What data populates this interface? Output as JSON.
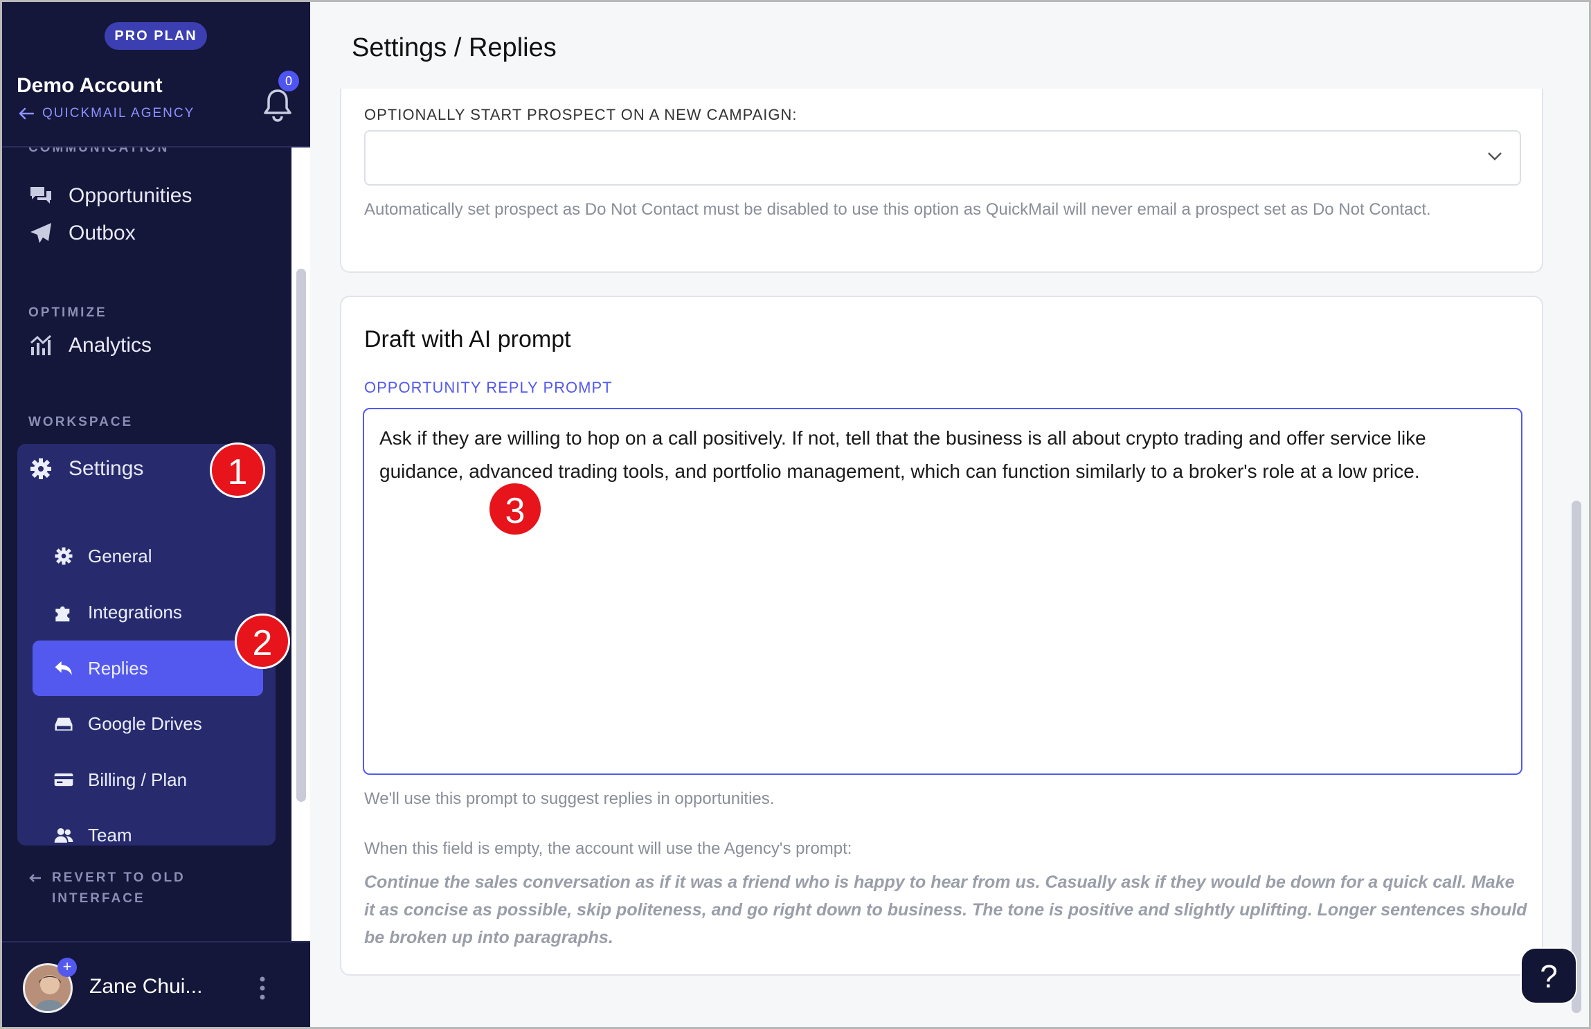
{
  "sidebar": {
    "plan_badge": "PRO PLAN",
    "account_name": "Demo Account",
    "agency_name": "QUICKMAIL AGENCY",
    "notification_count": "0",
    "cut_section_label": "COMMUNICATION",
    "nav": {
      "opportunities": "Opportunities",
      "outbox": "Outbox",
      "optimize_label": "OPTIMIZE",
      "analytics": "Analytics",
      "workspace_label": "WORKSPACE",
      "settings": "Settings"
    },
    "settings_sub": {
      "general": "General",
      "integrations": "Integrations",
      "replies": "Replies",
      "google_drives": "Google Drives",
      "billing": "Billing / Plan",
      "team": "Team"
    },
    "revert_line1": "REVERT TO OLD",
    "revert_line2": "INTERFACE",
    "user_name": "Zane Chui..."
  },
  "annotations": {
    "badge1": "1",
    "badge2": "2",
    "badge3": "3"
  },
  "main": {
    "page_title": "Settings / Replies",
    "campaign_card": {
      "label": "OPTIONALLY START PROSPECT ON A NEW CAMPAIGN:",
      "select_value": "",
      "hint": "Automatically set prospect as Do Not Contact must be disabled to use this option as QuickMail will never email a prospect set as Do Not Contact."
    },
    "ai_card": {
      "title": "Draft with AI prompt",
      "prompt_label": "OPPORTUNITY REPLY PROMPT",
      "prompt_value": "Ask if they are willing to hop on a call positively. If not, tell that the business is all about crypto trading and offer service like guidance, advanced trading tools, and portfolio management, which can function similarly to a broker's role at a low price.",
      "hint": "We'll use this prompt to suggest replies in opportunities.",
      "empty_hint": "When this field is empty, the account will use the Agency's prompt:",
      "agency_prompt": "Continue the sales conversation as if it was a friend who is happy to hear from us. Casually ask if they would be down for a quick call. Make it as concise as possible, skip politeness, and go right down to business. The tone is positive and slightly uplifting. Longer sentences should be broken up into paragraphs."
    },
    "help_label": "?"
  },
  "colors": {
    "sidebar_bg": "#14163a",
    "accent": "#5359ee",
    "settings_panel": "#272b6e",
    "annotation_red": "#e8141b"
  }
}
